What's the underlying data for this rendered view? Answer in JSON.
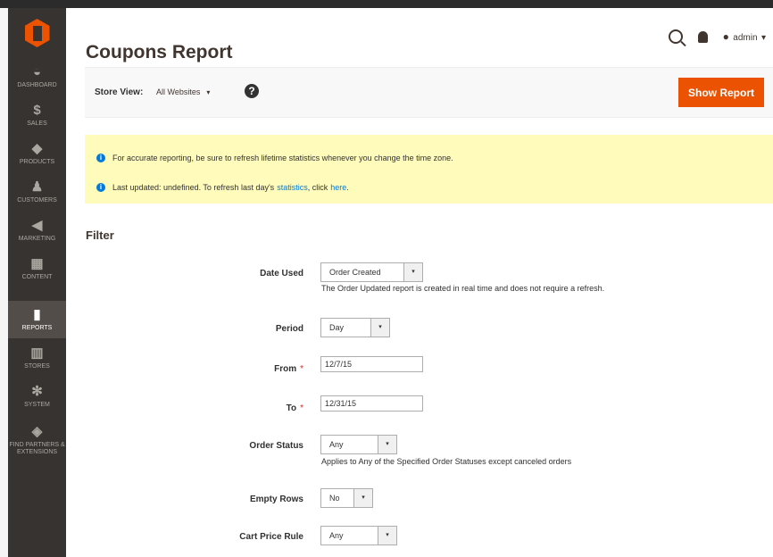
{
  "window": {
    "title": "Coupons Report"
  },
  "header": {
    "search_icon": "search-icon",
    "bell_icon": "bell-icon",
    "user_icon": "user-icon",
    "admin_label": "admin",
    "admin_caret": "▾"
  },
  "sidebar": {
    "items": [
      {
        "icon": "◒",
        "label": "Dashboard"
      },
      {
        "icon": "$",
        "label": "Sales"
      },
      {
        "icon": "◆",
        "label": "Products"
      },
      {
        "icon": "♟",
        "label": "Customers"
      },
      {
        "icon": "◀",
        "label": "Marketing"
      },
      {
        "icon": "▦",
        "label": "Content"
      },
      {
        "icon": "▮",
        "label": "Reports",
        "active": true
      },
      {
        "icon": "▥",
        "label": "Stores"
      },
      {
        "icon": "✻",
        "label": "System"
      },
      {
        "icon": "◈",
        "label": "Find Partners & Extensions"
      }
    ]
  },
  "toolbar": {
    "store_view_label": "Store View:",
    "store_view_value": "All Websites",
    "store_view_caret": "▾",
    "help_icon": "?",
    "show_report": "Show Report"
  },
  "notices": [
    {
      "icon": "i",
      "text": "For accurate reporting, be sure to refresh lifetime statistics whenever you change the time zone."
    },
    {
      "icon": "i",
      "text_before": "Last updated: undefined. To refresh last day's",
      "link_statistics": "statistics",
      "text_mid": ", click",
      "link_here": "here",
      "text_after": "."
    }
  ],
  "filter": {
    "title": "Filter",
    "fields": [
      {
        "label": "Date Used",
        "value": "Order Created",
        "note": "The Order Updated report is created in real time and does not require a refresh."
      },
      {
        "label": "Period",
        "value": "Day"
      },
      {
        "label": "From",
        "value": "12/7/15",
        "required": "*"
      },
      {
        "label": "To",
        "value": "12/31/15",
        "required": "*"
      },
      {
        "label": "Order Status",
        "value": "Any",
        "note": "Applies to Any of the Specified Order Statuses except canceled orders"
      },
      {
        "label": "Empty Rows",
        "value": "No"
      },
      {
        "label": "Cart Price Rule",
        "value": "Any"
      }
    ],
    "dropdown_caret": "▾"
  },
  "colors": {
    "accent": "#eb5202",
    "sidebar": "#373330",
    "notice": "#fffbbb",
    "info": "#007bdb"
  }
}
